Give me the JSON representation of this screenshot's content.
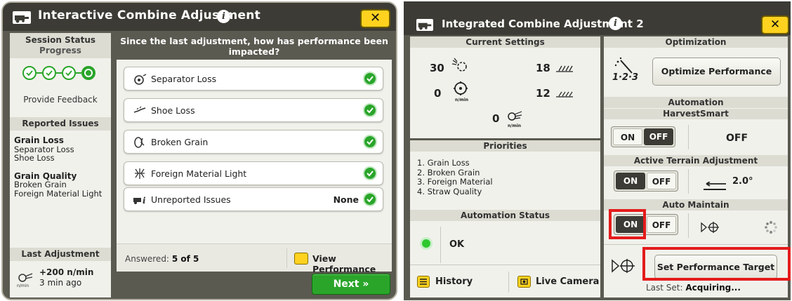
{
  "left": {
    "title": "Interactive Combine Adjustment",
    "close": "✕",
    "sidebar": {
      "session_status": "Session Status",
      "progress": "Progress",
      "progress_steps": 4,
      "progress_current": 4,
      "provide_feedback": "Provide Feedback",
      "reported_issues": "Reported Issues",
      "issue_groups": [
        {
          "title": "Grain Loss",
          "items": [
            "Separator Loss",
            "Shoe Loss"
          ]
        },
        {
          "title": "Grain Quality",
          "items": [
            "Broken Grain",
            "Foreign Material Light"
          ]
        }
      ],
      "last_adjustment": "Last Adjustment",
      "last_value": "+200 n/min",
      "last_time": "3 min ago"
    },
    "question": "Since the last adjustment, how has performance been impacted?",
    "items": [
      {
        "label": "Separator Loss",
        "icon": "separator-icon",
        "value": "",
        "checked": true
      },
      {
        "label": "Shoe Loss",
        "icon": "shoe-icon",
        "value": "",
        "checked": true
      },
      {
        "label": "Broken Grain",
        "icon": "broken-grain-icon",
        "value": "",
        "checked": true
      },
      {
        "label": "Foreign Material Light",
        "icon": "foreign-material-icon",
        "value": "",
        "checked": true
      },
      {
        "label": "Unreported Issues",
        "icon": "unreported-icon",
        "value": "None",
        "checked": true
      }
    ],
    "answered_label": "Answered:",
    "answered_value": "5 of 5",
    "view_performance": "View Performance",
    "next": "Next »"
  },
  "right": {
    "title": "Integrated Combine Adjustment 2",
    "close": "✕",
    "current_settings": {
      "header": "Current Settings",
      "rotor_speed": "30",
      "fan_speed": "18",
      "concave": "0",
      "sieve": "12",
      "feeder": "0",
      "unit_label": "n/min"
    },
    "priorities": {
      "header": "Priorities",
      "items": [
        "1. Grain Loss",
        "2. Broken Grain",
        "3. Foreign Material",
        "4. Straw Quality"
      ]
    },
    "automation_status": {
      "header": "Automation Status",
      "status": "OK",
      "history": "History",
      "live_camera": "Live Camera"
    },
    "optimization": {
      "header": "Optimization",
      "icon_label": "1·2·3",
      "optimize_button": "Optimize Performance"
    },
    "automation": {
      "header": "Automation",
      "harvestsmart": "HarvestSmart",
      "harvestsmart_value": "OFF",
      "active_terrain": "Active Terrain Adjustment",
      "terrain_value": "2.0°",
      "auto_maintain": "Auto Maintain",
      "on": "ON",
      "off": "OFF",
      "set_target_button": "Set Performance Target",
      "last_set_label": "Last Set:",
      "last_set_value": "Acquiring..."
    },
    "colors": {
      "accent": "#ffd21f",
      "ok": "#2aa52a",
      "highlight": "#e41b1b"
    }
  }
}
